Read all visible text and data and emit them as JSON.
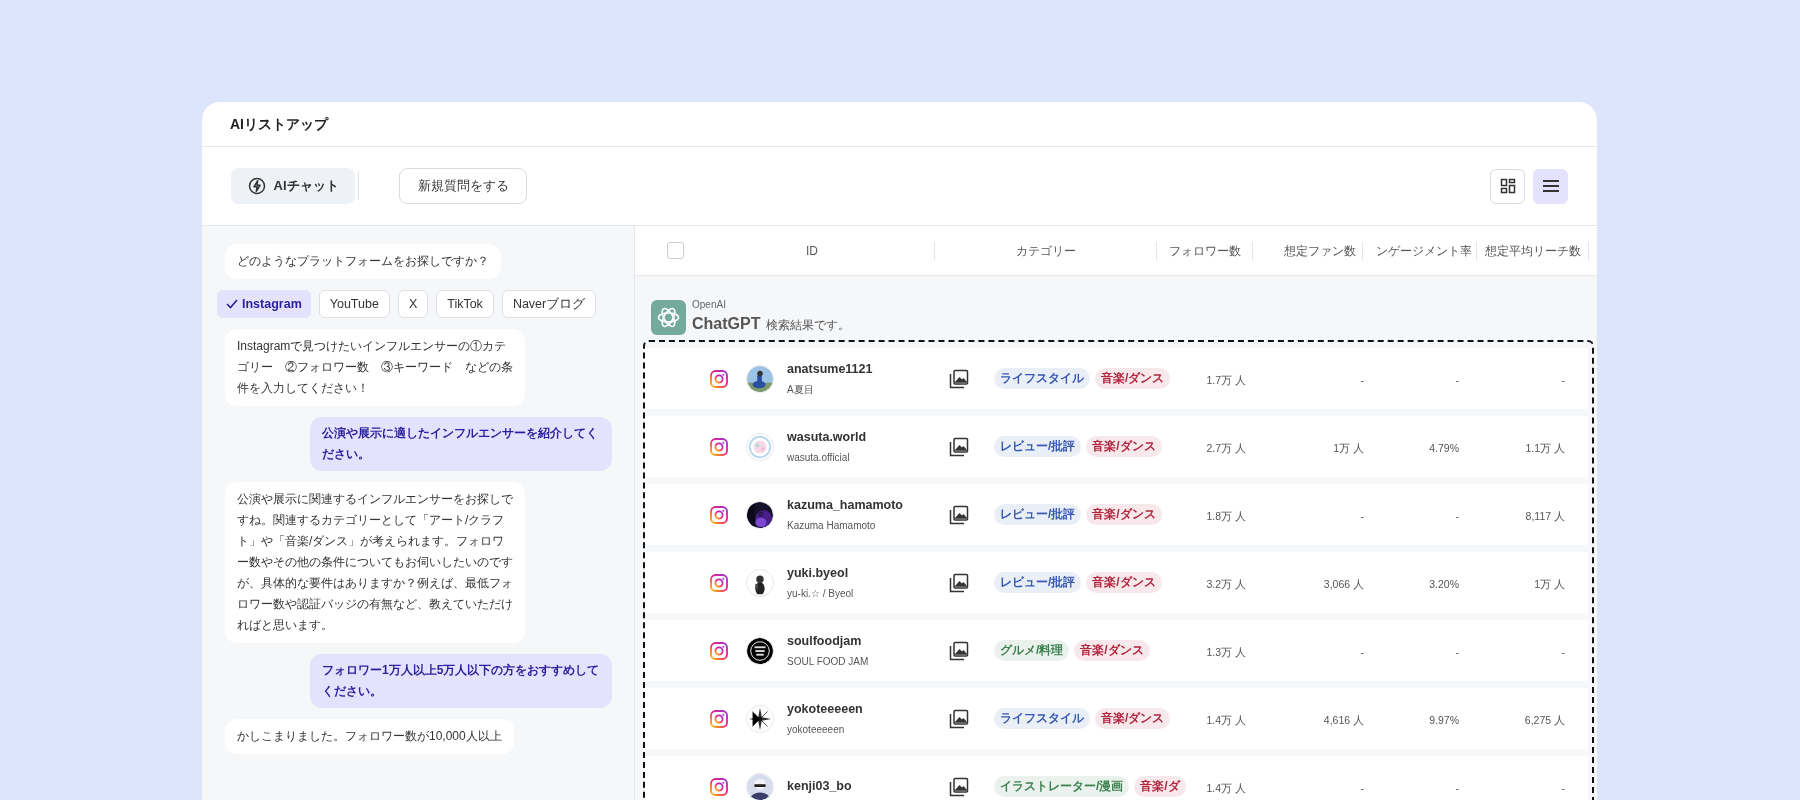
{
  "app_title": "AIリストアップ",
  "toolbar": {
    "chat_button": "AIチャット",
    "new_question_button": "新規質問をする",
    "view_buttons": [
      {
        "kind": "grid",
        "selected": false
      },
      {
        "kind": "list",
        "selected": true
      }
    ]
  },
  "chat": [
    {
      "kind": "bot",
      "text": "どのようなプラットフォームをお探しですか？"
    },
    {
      "kind": "options",
      "options": [
        {
          "label": "Instagram",
          "selected": true
        },
        {
          "label": "YouTube",
          "selected": false
        },
        {
          "label": "X",
          "selected": false
        },
        {
          "label": "TikTok",
          "selected": false
        },
        {
          "label": "Naverブログ",
          "selected": false
        }
      ]
    },
    {
      "kind": "bot",
      "text": "Instagramで見つけたいインフルエンサーの①カテゴリー　②フォロワー数　③キーワード　などの条件を入力してください！"
    },
    {
      "kind": "user",
      "text": "公演や展示に適したインフルエンサーを紹介してください。"
    },
    {
      "kind": "bot",
      "text": "公演や展示に関連するインフルエンサーをお探しですね。関連するカテゴリーとして「アート/クラフト」や「音楽/ダンス」が考えられます。フォロワー数やその他の条件についてもお伺いしたいのですが、具体的な要件はありますか？例えば、最低フォロワー数や認証バッジの有無など、教えていただければと思います。"
    },
    {
      "kind": "user",
      "text": "フォロワー1万人以上5万人以下の方をおすすめしてください。"
    },
    {
      "kind": "bot",
      "text": "かしこまりました。フォロワー数が10,000人以上"
    }
  ],
  "table": {
    "select_all_checked": false,
    "columns": [
      "ID",
      "カテゴリー",
      "フォロワー数",
      "想定ファン数",
      "ンゲージメント率",
      "想定平均リーチ数"
    ],
    "source": {
      "provider": "OpenAI",
      "name": "ChatGPT",
      "note": "検索結果です。"
    },
    "rows": [
      {
        "id": "anatsume1121",
        "display_name": "A夏目",
        "tags": [
          {
            "label": "ライフスタイル",
            "color": "#3559b0"
          },
          {
            "label": "音楽/ダンス",
            "color": "#b3263f"
          }
        ],
        "followers": "1.7万 人",
        "fans": "-",
        "engagement": "-",
        "reach": "-"
      },
      {
        "id": "wasuta.world",
        "display_name": "wasuta.official",
        "tags": [
          {
            "label": "レビュー/批評",
            "color": "#3559b0"
          },
          {
            "label": "音楽/ダンス",
            "color": "#b3263f"
          }
        ],
        "followers": "2.7万 人",
        "fans": "1万 人",
        "engagement": "4.79%",
        "reach": "1.1万 人"
      },
      {
        "id": "kazuma_hamamoto",
        "display_name": "Kazuma Hamamoto",
        "tags": [
          {
            "label": "レビュー/批評",
            "color": "#3559b0"
          },
          {
            "label": "音楽/ダンス",
            "color": "#b3263f"
          }
        ],
        "followers": "1.8万 人",
        "fans": "-",
        "engagement": "-",
        "reach": "8,117 人"
      },
      {
        "id": "yuki.byeol",
        "display_name": "yu-ki.☆ / Byeol",
        "tags": [
          {
            "label": "レビュー/批評",
            "color": "#3559b0"
          },
          {
            "label": "音楽/ダンス",
            "color": "#b3263f"
          }
        ],
        "followers": "3.2万 人",
        "fans": "3,066 人",
        "engagement": "3.20%",
        "reach": "1万 人"
      },
      {
        "id": "soulfoodjam",
        "display_name": "SOUL FOOD JAM",
        "tags": [
          {
            "label": "グルメ/料理",
            "color": "#3b8150"
          },
          {
            "label": "音楽/ダンス",
            "color": "#b3263f"
          }
        ],
        "followers": "1.3万 人",
        "fans": "-",
        "engagement": "-",
        "reach": "-"
      },
      {
        "id": "yokoteeeeen",
        "display_name": "yokoteeeeen",
        "tags": [
          {
            "label": "ライフスタイル",
            "color": "#3559b0"
          },
          {
            "label": "音楽/ダンス",
            "color": "#b3263f"
          }
        ],
        "followers": "1.4万 人",
        "fans": "4,616 人",
        "engagement": "9.97%",
        "reach": "6,275 人"
      },
      {
        "id": "kenji03_bo",
        "tags": [
          {
            "label": "イラストレーター/漫画",
            "color": "#3b8150"
          },
          {
            "label": "音楽/ダ",
            "color": "#b3263f"
          }
        ],
        "followers": "1.4万 人",
        "fans": "-",
        "engagement": "-",
        "reach": "-"
      }
    ]
  }
}
